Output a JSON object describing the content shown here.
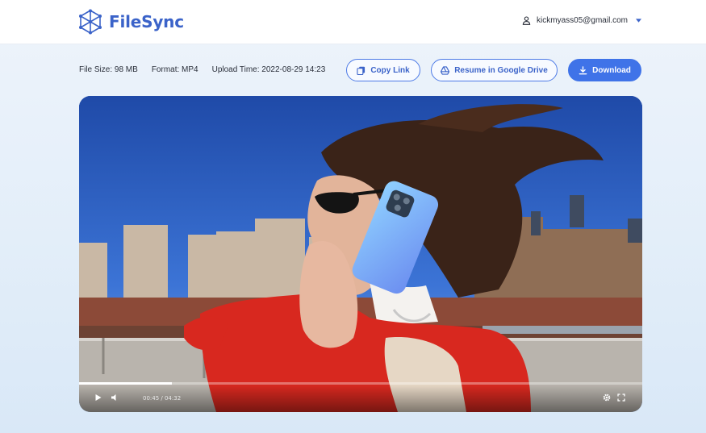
{
  "app": {
    "name": "FileSync",
    "brand_color": "#3b63c9"
  },
  "account": {
    "email": "kickmyass05@gmail.com"
  },
  "file": {
    "size": "File Size: 98 MB",
    "format": "Format: MP4",
    "upload_time": "Upload Time: 2022-08-29 14:23"
  },
  "actions": {
    "copy_link": "Copy Link",
    "resume_drive": "Resume in Google Drive",
    "download": "Download"
  },
  "player": {
    "current_time": "00:45",
    "duration": "04:32",
    "time_display": "00:45 / 04:32",
    "progress_fraction": 0.165,
    "accent": "#ffffff"
  },
  "icons": {
    "logo": "cube-network-logo",
    "user": "user-icon",
    "chevron": "chevron-down-icon",
    "copy": "copy-icon",
    "drive": "google-drive-icon",
    "download": "download-icon",
    "play": "play-icon",
    "volume": "volume-icon",
    "settings": "gear-icon",
    "fullscreen": "fullscreen-icon"
  }
}
